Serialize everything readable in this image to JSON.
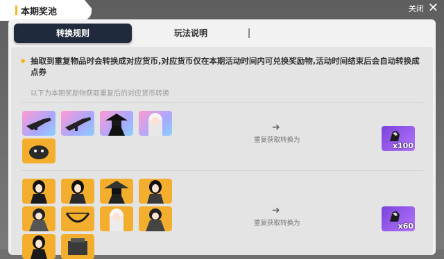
{
  "header": {
    "title": "本期奖池",
    "close_label": "关闭"
  },
  "tabs": [
    {
      "label": "转换规则",
      "active": true
    },
    {
      "label": "玩法说明",
      "active": false
    }
  ],
  "notice": "抽取到重复物品时会转换成对应货币,对应货币仅在本期活动时间内可兑换奖励物,活动时间结束后会自动转换成点券",
  "sub_note": "以下为本期奖励物获取重复后的对应货币转换",
  "groups": [
    {
      "items": [
        "weapon-rifle-icon",
        "weapon-rifle-icon",
        "character-hat-icon",
        "character-white-hair-icon",
        "pet-black-icon"
      ],
      "conversion_label": "重复获取转换为",
      "reward": {
        "icon": "currency-icon",
        "count": "x100"
      }
    },
    {
      "items": [
        "character-icon",
        "character-icon",
        "character-hat-icon",
        "character-icon",
        "character-icon",
        "weapon-bow-icon",
        "character-white-hair-icon",
        "character-icon",
        "character-icon",
        "weapon-crate-icon"
      ],
      "conversion_label": "重复获取转换为",
      "reward": {
        "icon": "currency-icon",
        "count": "x60"
      }
    }
  ],
  "colors": {
    "accent": "#f5b81f",
    "tab_active_bg": "#1f2b3d",
    "reward_bg": "#8a4fe6",
    "item_orange": "#f4ae2e"
  }
}
